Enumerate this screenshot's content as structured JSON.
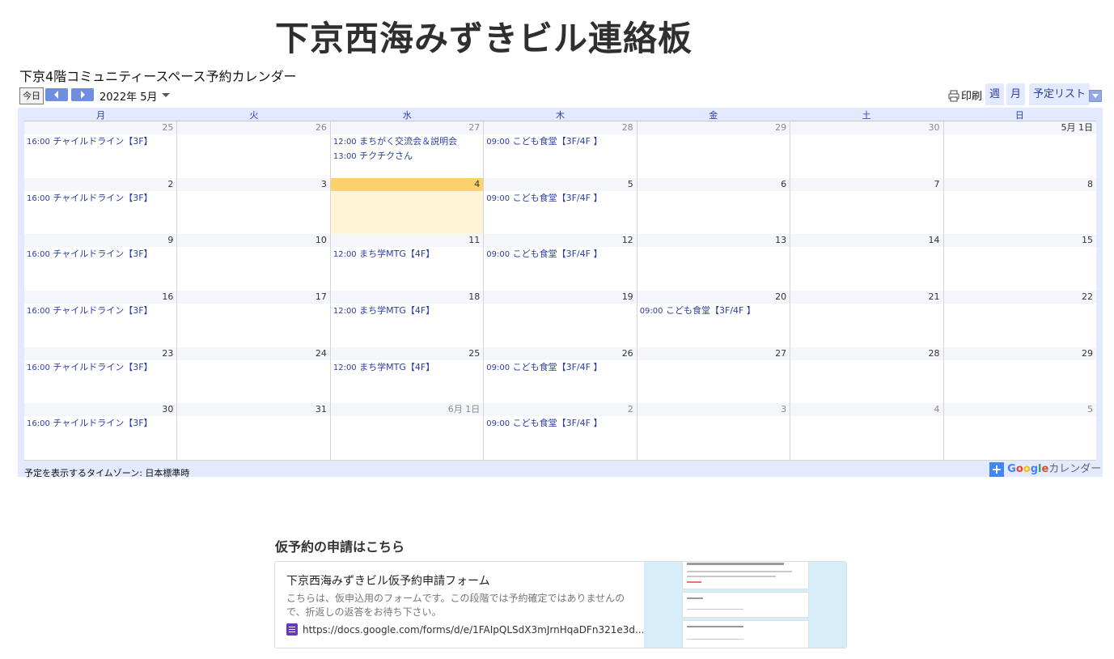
{
  "site": {
    "title": "下京西海みずきビル連絡板"
  },
  "calendar": {
    "title": "下京4階コミュニティースペース予約カレンダー",
    "today_label": "今日",
    "current_date": "2022年 5月",
    "print_label": "印刷",
    "views": {
      "week": "週",
      "month": "月",
      "agenda": "予定リスト"
    },
    "weekdays": [
      "月",
      "火",
      "水",
      "木",
      "金",
      "土",
      "日"
    ],
    "weeks": [
      [
        {
          "d": "25",
          "other": true,
          "events": [
            {
              "time": "16:00",
              "title": "チャイルドライン【3F】"
            }
          ]
        },
        {
          "d": "26",
          "other": true,
          "events": []
        },
        {
          "d": "27",
          "other": true,
          "events": [
            {
              "time": "12:00",
              "title": "まちがく交流会＆説明会"
            },
            {
              "time": "13:00",
              "title": "チクチクさん"
            }
          ]
        },
        {
          "d": "28",
          "other": true,
          "events": [
            {
              "time": "09:00",
              "title": "こども食堂【3F/4F 】"
            }
          ]
        },
        {
          "d": "29",
          "other": true,
          "events": []
        },
        {
          "d": "30",
          "other": true,
          "events": []
        },
        {
          "d": "5月 1日",
          "other": false,
          "events": []
        }
      ],
      [
        {
          "d": "2",
          "events": [
            {
              "time": "16:00",
              "title": "チャイルドライン【3F】"
            }
          ]
        },
        {
          "d": "3",
          "events": []
        },
        {
          "d": "4",
          "today": true,
          "events": []
        },
        {
          "d": "5",
          "events": [
            {
              "time": "09:00",
              "title": "こども食堂【3F/4F 】"
            }
          ]
        },
        {
          "d": "6",
          "events": []
        },
        {
          "d": "7",
          "events": []
        },
        {
          "d": "8",
          "events": []
        }
      ],
      [
        {
          "d": "9",
          "events": [
            {
              "time": "16:00",
              "title": "チャイルドライン【3F】"
            }
          ]
        },
        {
          "d": "10",
          "events": []
        },
        {
          "d": "11",
          "events": [
            {
              "time": "12:00",
              "title": "まち学MTG【4F】"
            }
          ]
        },
        {
          "d": "12",
          "events": [
            {
              "time": "09:00",
              "title": "こども食堂【3F/4F 】"
            }
          ]
        },
        {
          "d": "13",
          "events": []
        },
        {
          "d": "14",
          "events": []
        },
        {
          "d": "15",
          "events": []
        }
      ],
      [
        {
          "d": "16",
          "events": [
            {
              "time": "16:00",
              "title": "チャイルドライン【3F】"
            }
          ]
        },
        {
          "d": "17",
          "events": []
        },
        {
          "d": "18",
          "events": [
            {
              "time": "12:00",
              "title": "まち学MTG【4F】"
            }
          ]
        },
        {
          "d": "19",
          "events": []
        },
        {
          "d": "20",
          "events": [
            {
              "time": "09:00",
              "title": "こども食堂【3F/4F 】"
            }
          ]
        },
        {
          "d": "21",
          "events": []
        },
        {
          "d": "22",
          "events": []
        }
      ],
      [
        {
          "d": "23",
          "events": [
            {
              "time": "16:00",
              "title": "チャイルドライン【3F】"
            }
          ]
        },
        {
          "d": "24",
          "events": []
        },
        {
          "d": "25",
          "events": [
            {
              "time": "12:00",
              "title": "まち学MTG【4F】"
            }
          ]
        },
        {
          "d": "26",
          "events": [
            {
              "time": "09:00",
              "title": "こども食堂【3F/4F 】"
            }
          ]
        },
        {
          "d": "27",
          "events": []
        },
        {
          "d": "28",
          "events": []
        },
        {
          "d": "29",
          "events": []
        }
      ],
      [
        {
          "d": "30",
          "events": [
            {
              "time": "16:00",
              "title": "チャイルドライン【3F】"
            }
          ]
        },
        {
          "d": "31",
          "events": []
        },
        {
          "d": "6月 1日",
          "other": true,
          "events": []
        },
        {
          "d": "2",
          "other": true,
          "events": [
            {
              "time": "09:00",
              "title": "こども食堂【3F/4F 】"
            }
          ]
        },
        {
          "d": "3",
          "other": true,
          "events": []
        },
        {
          "d": "4",
          "other": true,
          "events": []
        },
        {
          "d": "5",
          "other": true,
          "events": []
        }
      ]
    ],
    "timezone_note": "予定を表示するタイムゾーン: 日本標準時",
    "google_badge": {
      "plus": "+",
      "google": "Google",
      "calendar": "カレンダー"
    }
  },
  "form_section": {
    "heading": "仮予約の申請はこちら",
    "card": {
      "title": "下京西海みずきビル仮予約申請フォーム",
      "description": "こちらは、仮申込用のフォームです。この段階では予約確定ではありませんので、折返しの返答をお待ち下さい。",
      "url": "https://docs.google.com/forms/d/e/1FAIpQLSdX3mJrnHqaDFn321e3d..."
    }
  },
  "colors": {
    "accent": "#2a3f9e",
    "calendar_bg": "#e3e9ff",
    "today_head": "#fcd26f",
    "today_cell": "#fff4d6",
    "nav_button": "#6f8fde",
    "forms_purple": "#673ab7"
  },
  "icons": {
    "prev": "chevron-left-icon",
    "next": "chevron-right-icon",
    "print": "printer-icon",
    "forms": "google-forms-icon"
  }
}
